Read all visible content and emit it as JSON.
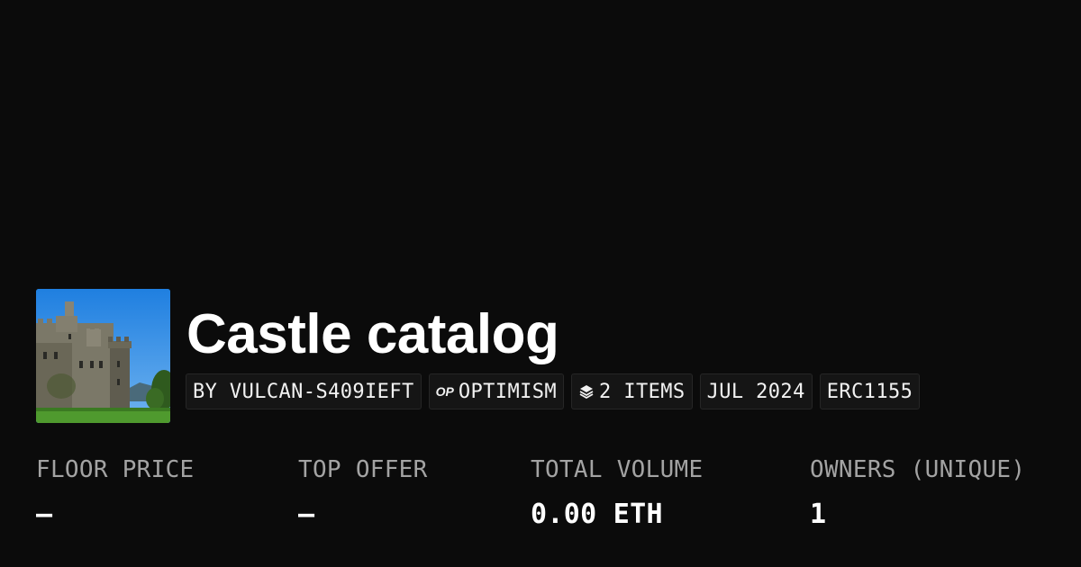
{
  "collection": {
    "title": "Castle catalog",
    "thumbnail_icon": "castle-photo"
  },
  "tags": [
    {
      "label": "BY VULCAN-S409IEFT"
    },
    {
      "label": "OPTIMISM",
      "icon": "optimism-logo-icon",
      "icon_text": "OP"
    },
    {
      "label": "2 ITEMS",
      "icon": "layers-icon"
    },
    {
      "label": "JUL 2024"
    },
    {
      "label": "ERC1155"
    }
  ],
  "stats": [
    {
      "label": "FLOOR PRICE",
      "value": "–"
    },
    {
      "label": "TOP OFFER",
      "value": "–"
    },
    {
      "label": "TOTAL VOLUME",
      "value": "0.00 ETH"
    },
    {
      "label": "OWNERS (UNIQUE)",
      "value": "1"
    }
  ],
  "colors": {
    "background": "#0b0b0b",
    "tag_background": "#151515",
    "label_gray": "#a3a3a3",
    "text": "#ffffff"
  }
}
